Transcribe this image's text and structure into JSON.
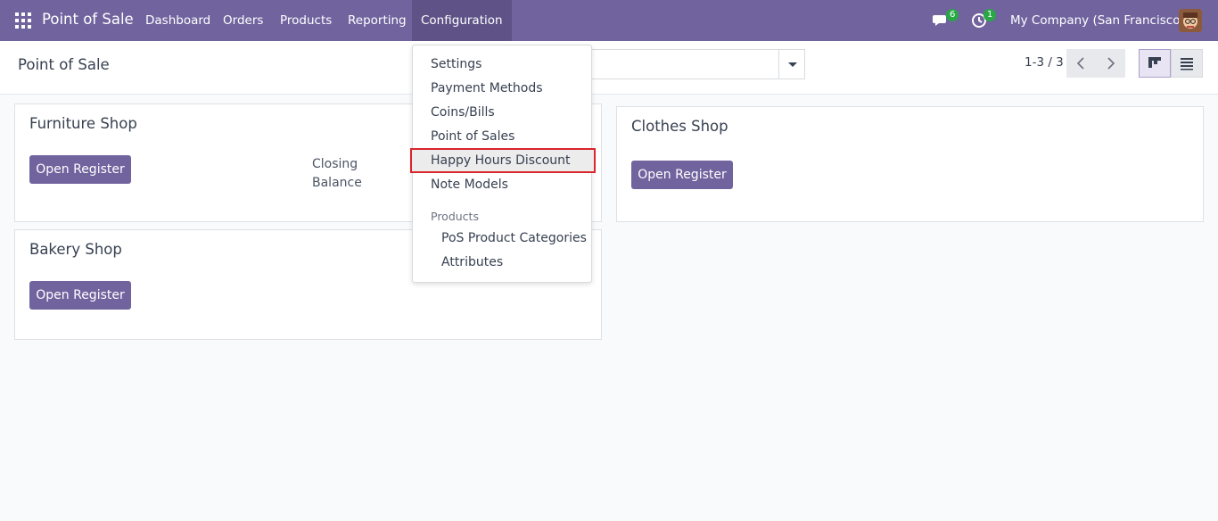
{
  "navbar": {
    "brand": "Point of Sale",
    "menu": [
      "Dashboard",
      "Orders",
      "Products",
      "Reporting",
      "Configuration"
    ],
    "chat_count": "6",
    "activity_count": "1",
    "company": "My Company (San Francisco)"
  },
  "control_panel": {
    "title": "Point of Sale",
    "pager": "1-3 / 3"
  },
  "cards": [
    {
      "title": "Furniture Shop",
      "button": "Open Register",
      "closing_label_1": "Closing",
      "closing_label_2": "Balance"
    },
    {
      "title": "Bakery Shop",
      "button": "Open Register"
    },
    {
      "title": "Clothes Shop",
      "button": "Open Register"
    }
  ],
  "dropdown": {
    "items": [
      "Settings",
      "Payment Methods",
      "Coins/Bills",
      "Point of Sales",
      "Happy Hours Discount",
      "Note Models"
    ],
    "section_header": "Products",
    "sub_items": [
      "PoS Product Categories",
      "Attributes"
    ]
  },
  "colors": {
    "brand": "#71639e",
    "highlight_border": "#d9262c",
    "badge": "#28a745"
  }
}
